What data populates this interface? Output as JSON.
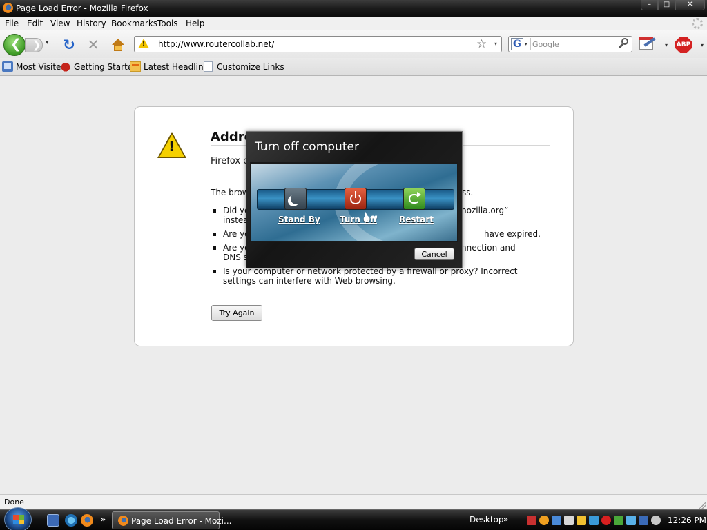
{
  "window": {
    "title": "Page Load Error - Mozilla Firefox",
    "min_glyph": "–",
    "max_glyph": "□",
    "close_glyph": "✕"
  },
  "menu": [
    "File",
    "Edit",
    "View",
    "History",
    "Bookmarks",
    "Tools",
    "Help"
  ],
  "nav": {
    "url": "http://www.routercollab.net/",
    "search_placeholder": "Google",
    "back_glyph": "❮",
    "forward_glyph": "❯",
    "reload_glyph": "↻",
    "stop_glyph": "✕",
    "star_glyph": "☆",
    "dropdown_glyph": "▾",
    "search_engine_glyph": "G",
    "adblock_label": "ABP"
  },
  "bookmarks": [
    "Most Visited",
    "Getting Started",
    "Latest Headlines",
    "Customize Links"
  ],
  "error": {
    "title": "Addre",
    "subtitle": "Firefox c",
    "intro": "The brow",
    "intro_tail": "ss.",
    "items": [
      {
        "left": "Did yo",
        "left2": "instea",
        "right": "nozilla.org”"
      },
      {
        "left": "Are yo",
        "right": "have expired."
      },
      {
        "left": "Are yo",
        "left2": "DNS s",
        "right": "nnection and"
      },
      {
        "left": "Is your computer or network protected by a firewall or proxy? Incorrect",
        "left2": "settings can interfere with Web browsing."
      }
    ],
    "try_again": "Try Again"
  },
  "shutdown": {
    "title": "Turn off computer",
    "standby": "Stand By",
    "turnoff": "Turn Off",
    "restart": "Restart",
    "cancel": "Cancel"
  },
  "status": "Done",
  "taskbar": {
    "task_label": "Page Load Error - Mozi...",
    "desktop": "Desktop",
    "more_glyph": "»",
    "clock": "12:26 PM"
  },
  "colors": {
    "accent": "#3d9a25",
    "warning": "#f5d000",
    "adblock": "#d42222"
  }
}
